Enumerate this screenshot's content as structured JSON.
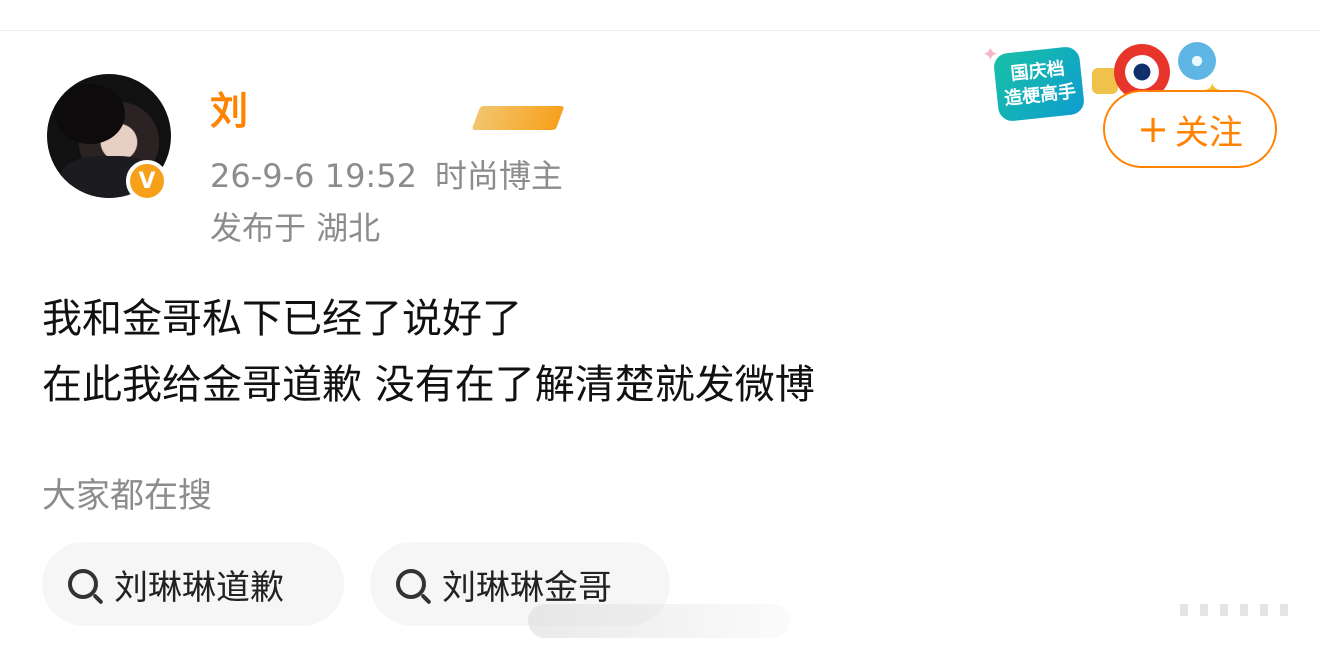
{
  "post": {
    "user": {
      "display_name": "刘",
      "verified_badge": "V"
    },
    "time": "26-9-6 19:52",
    "user_tag": "时尚博主",
    "location": "发布于 湖北",
    "text_lines": [
      "我和金哥私下已经了说好了",
      "在此我给金哥道歉 没有在了解清楚就发微博"
    ]
  },
  "event_badge": {
    "line1": "国庆档",
    "line2": "造梗高手"
  },
  "follow_button": {
    "plus": "+",
    "label": "关注"
  },
  "trending": {
    "heading": "大家都在搜",
    "chips": [
      {
        "label": "刘琳琳道歉"
      },
      {
        "label": "刘琳琳金哥"
      }
    ]
  },
  "colors": {
    "accent": "#ff8200",
    "muted_text": "#8c8c8c",
    "chip_bg": "#f6f6f6"
  }
}
